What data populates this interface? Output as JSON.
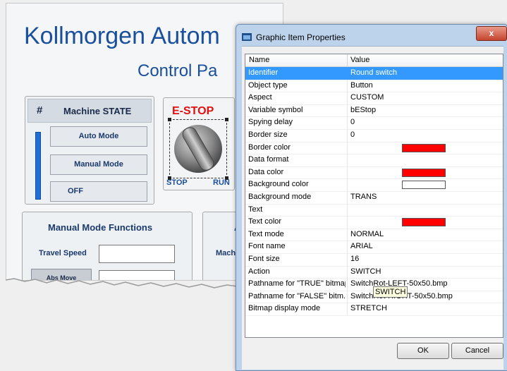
{
  "hmi": {
    "title": "Kollmorgen Autom",
    "subtitle": "Control Pa",
    "machine_state": {
      "hash": "#",
      "title": "Machine STATE",
      "buttons": [
        "Auto Mode",
        "Manual Mode",
        "OFF"
      ]
    },
    "estop": {
      "title": "E-STOP",
      "stop_label": "STOP",
      "run_label": "RUN"
    },
    "manual_functions": {
      "title": "Manual Mode Functions",
      "travel_speed_label": "Travel Speed",
      "abs_move_label": "Abs Move"
    },
    "second_panel": {
      "title_fragment": "A",
      "machine_label": "Mach"
    }
  },
  "dialog": {
    "title": "Graphic Item Properties",
    "close_label": "x",
    "columns": {
      "name": "Name",
      "value": "Value"
    },
    "rows": [
      {
        "name": "Identifier",
        "value": "Round switch",
        "selected": true
      },
      {
        "name": "Object type",
        "value": "Button"
      },
      {
        "name": "Aspect",
        "value": "CUSTOM"
      },
      {
        "name": "Variable symbol",
        "value": "bEStop"
      },
      {
        "name": "Spying delay",
        "value": "0"
      },
      {
        "name": "Border size",
        "value": "0"
      },
      {
        "name": "Border color",
        "value": "",
        "swatch": "#ff0000"
      },
      {
        "name": "Data format",
        "value": ""
      },
      {
        "name": "Data color",
        "value": "",
        "swatch": "#ff0000"
      },
      {
        "name": "Background color",
        "value": "",
        "swatch": "#ffffff"
      },
      {
        "name": "Background mode",
        "value": "TRANS"
      },
      {
        "name": "Text",
        "value": ""
      },
      {
        "name": "Text color",
        "value": "",
        "swatch": "#ff0000"
      },
      {
        "name": "Text mode",
        "value": "NORMAL"
      },
      {
        "name": "Font name",
        "value": "ARIAL"
      },
      {
        "name": "Font size",
        "value": "16"
      },
      {
        "name": "Action",
        "value": "SWITCH"
      },
      {
        "name": "Pathname for \"TRUE\" bitmap",
        "value": "SwitchRot-LEFT-50x50.bmp"
      },
      {
        "name": "Pathname for \"FALSE\" bitm...",
        "value": "SwitchRot-RIGHT-50x50.bmp"
      },
      {
        "name": "Bitmap display mode",
        "value": "STRETCH"
      }
    ],
    "tooltip": "SWITCH",
    "ok_label": "OK",
    "cancel_label": "Cancel"
  },
  "colors": {
    "hmi_title": "#1a4f9c",
    "estop_red": "#e01010",
    "selection": "#3399ff",
    "dialog_frame": "#bdd3ec"
  }
}
